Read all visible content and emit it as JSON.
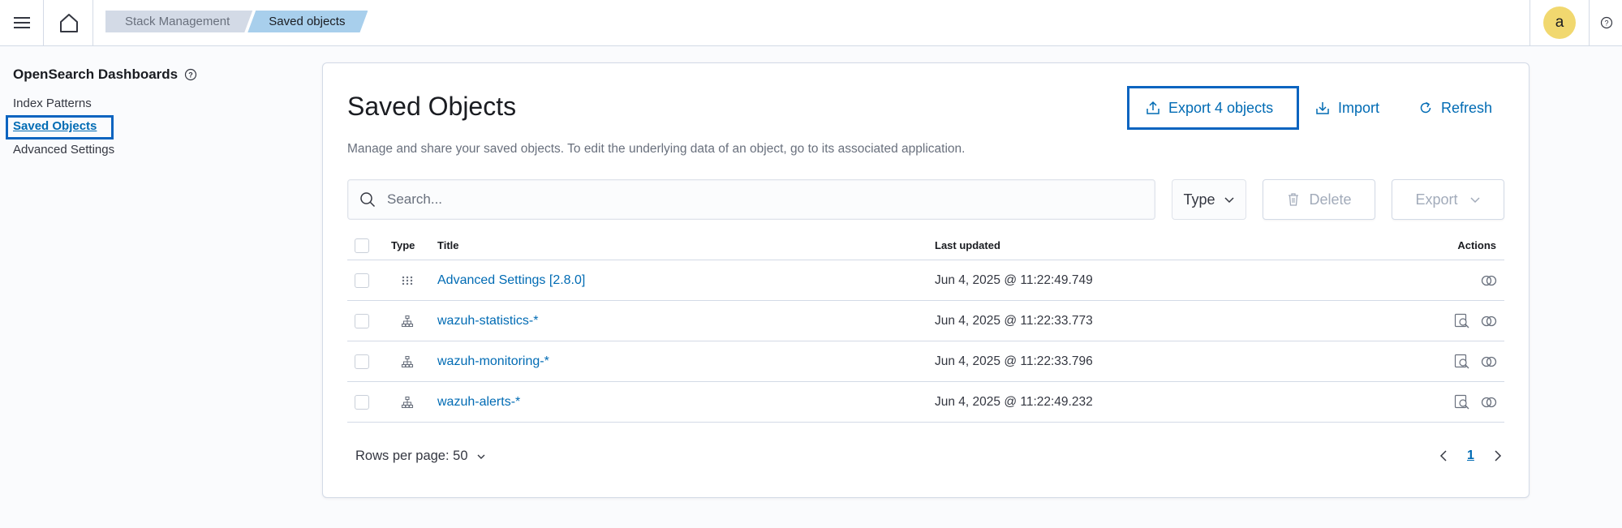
{
  "header": {
    "breadcrumbs": [
      "Stack Management",
      "Saved objects"
    ],
    "avatar_letter": "a"
  },
  "sidebar": {
    "title": "OpenSearch Dashboards",
    "items": [
      {
        "label": "Index Patterns",
        "selected": false
      },
      {
        "label": "Saved Objects",
        "selected": true
      },
      {
        "label": "Advanced Settings",
        "selected": false
      }
    ]
  },
  "main": {
    "title": "Saved Objects",
    "description": "Manage and share your saved objects. To edit the underlying data of an object, go to its associated application.",
    "actions": {
      "export_all": "Export 4 objects",
      "import": "Import",
      "refresh": "Refresh"
    },
    "search": {
      "placeholder": "Search...",
      "value": ""
    },
    "type_filter": "Type",
    "delete_label": "Delete",
    "export_label": "Export",
    "table": {
      "columns": [
        "Type",
        "Title",
        "Last updated",
        "Actions"
      ],
      "rows": [
        {
          "type_icon": "grid-dots-icon",
          "title": "Advanced Settings [2.8.0]",
          "updated": "Jun 4, 2025 @ 11:22:49.749",
          "inspect": false
        },
        {
          "type_icon": "index-pattern-icon",
          "title": "wazuh-statistics-*",
          "updated": "Jun 4, 2025 @ 11:22:33.773",
          "inspect": true
        },
        {
          "type_icon": "index-pattern-icon",
          "title": "wazuh-monitoring-*",
          "updated": "Jun 4, 2025 @ 11:22:33.796",
          "inspect": true
        },
        {
          "type_icon": "index-pattern-icon",
          "title": "wazuh-alerts-*",
          "updated": "Jun 4, 2025 @ 11:22:49.232",
          "inspect": true
        }
      ]
    },
    "rows_per_page": "Rows per page: 50",
    "current_page": "1"
  }
}
